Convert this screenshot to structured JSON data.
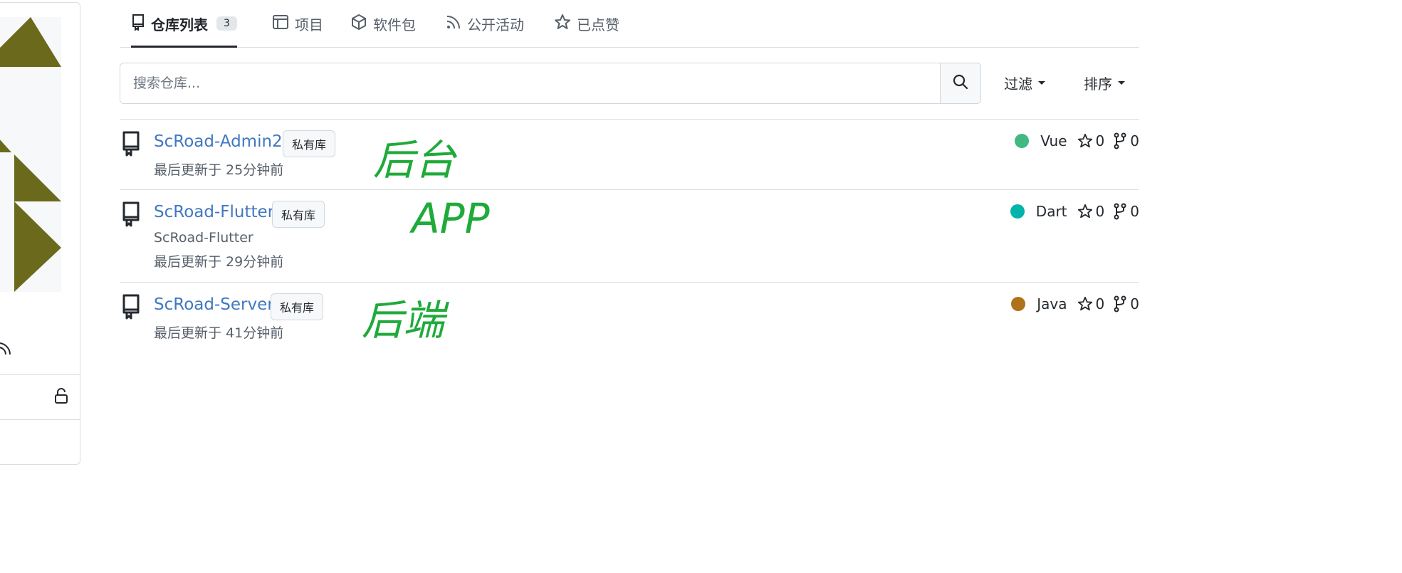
{
  "tabs": [
    {
      "label": "仓库列表",
      "count": "3",
      "icon": "repo-icon"
    },
    {
      "label": "项目",
      "icon": "project-icon"
    },
    {
      "label": "软件包",
      "icon": "package-icon"
    },
    {
      "label": "公开活动",
      "icon": "rss-icon"
    },
    {
      "label": "已点赞",
      "icon": "star-icon"
    }
  ],
  "search": {
    "placeholder": "搜索仓库..."
  },
  "filter_label": "过滤",
  "sort_label": "排序",
  "colors": {
    "link": "#4078c0",
    "annotation": "#1faa3a",
    "avatar": "#6b6a1c"
  },
  "repos": [
    {
      "name": "ScRoad-Admin2",
      "visibility": "私有库",
      "description": "",
      "updated": "最后更新于 25分钟前",
      "language": "Vue",
      "language_color": "#42b883",
      "stars": "0",
      "forks": "0",
      "annotation": "后台"
    },
    {
      "name": "ScRoad-Flutter",
      "visibility": "私有库",
      "description": "ScRoad-Flutter",
      "updated": "最后更新于 29分钟前",
      "language": "Dart",
      "language_color": "#00b4ab",
      "stars": "0",
      "forks": "0",
      "annotation": "APP"
    },
    {
      "name": "ScRoad-Server",
      "visibility": "私有库",
      "description": "",
      "updated": "最后更新于 41分钟前",
      "language": "Java",
      "language_color": "#b07219",
      "stars": "0",
      "forks": "0",
      "annotation": "后端"
    }
  ]
}
